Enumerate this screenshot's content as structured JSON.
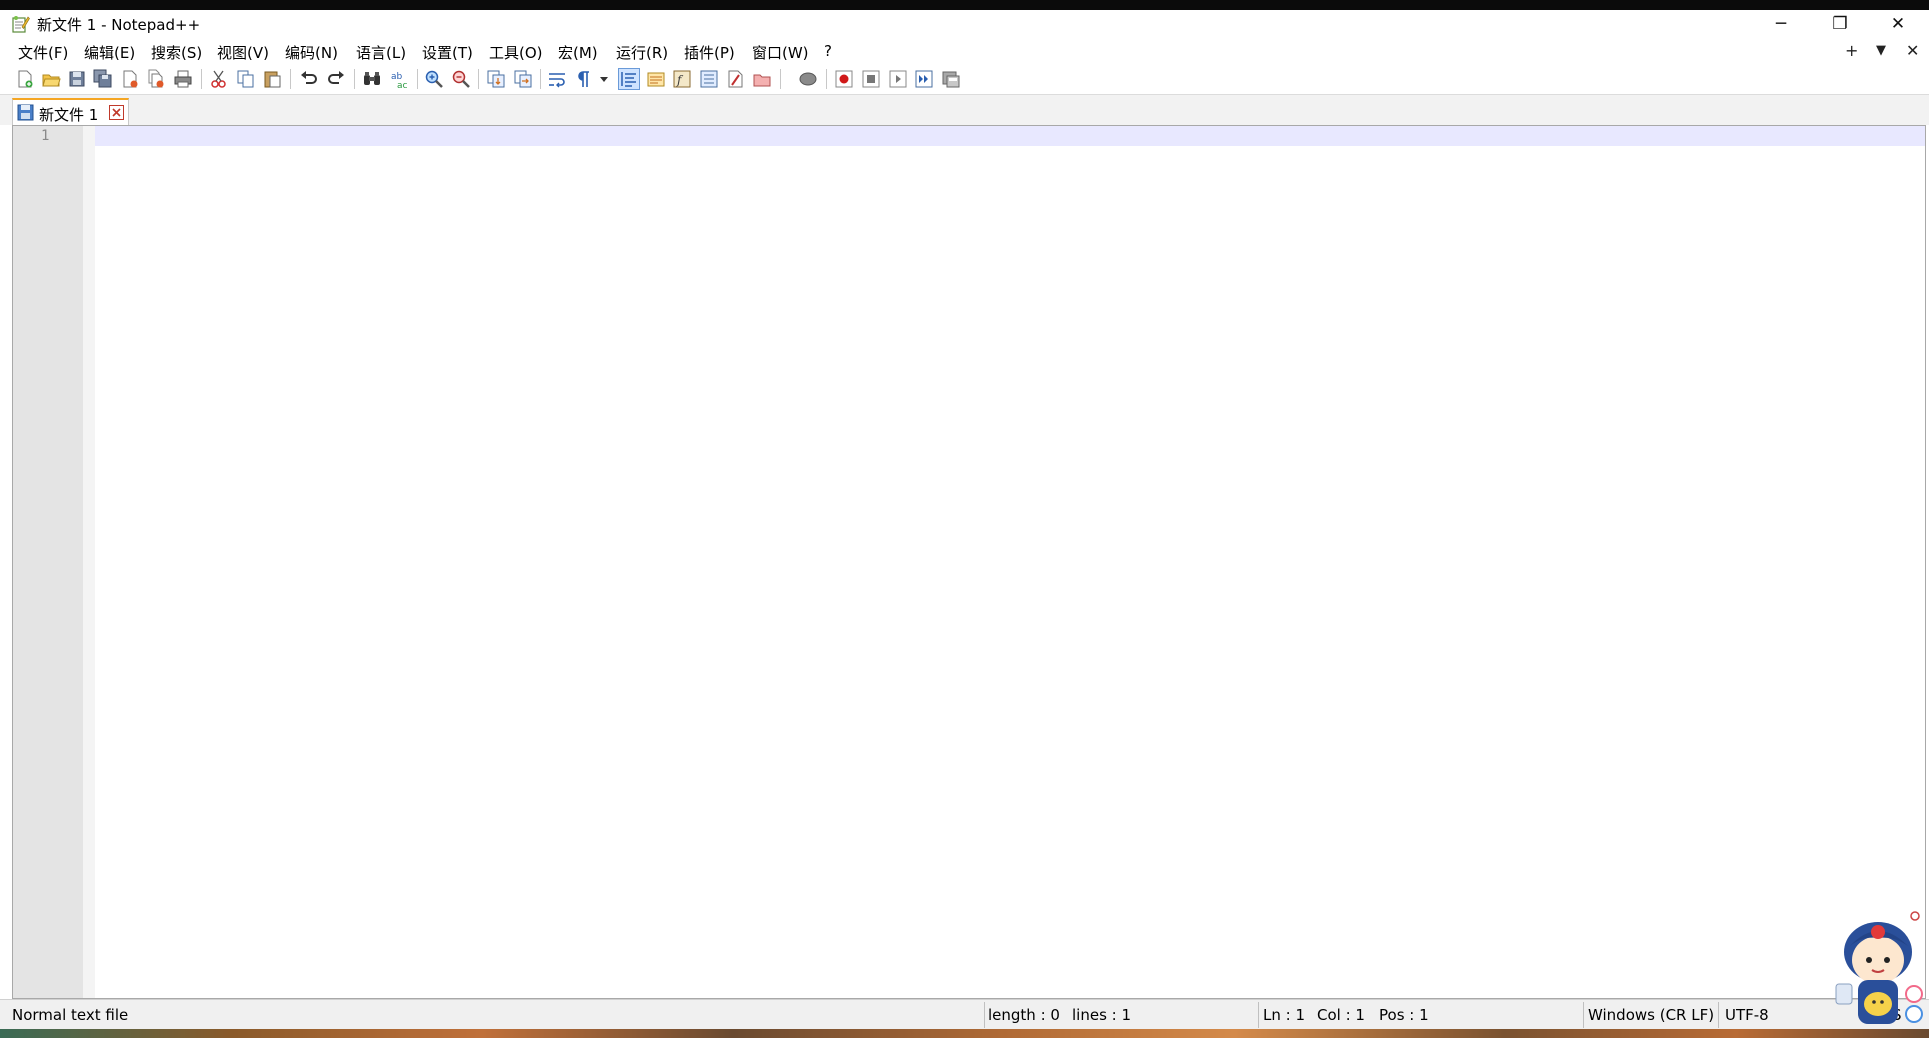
{
  "window": {
    "title": "新文件 1 - Notepad++",
    "minimize_glyph": "─",
    "restore_glyph": "❐",
    "close_glyph": "✕"
  },
  "menu": {
    "items": [
      "文件(F)",
      "编辑(E)",
      "搜索(S)",
      "视图(V)",
      "编码(N)",
      "语言(L)",
      "设置(T)",
      "工具(O)",
      "宏(M)",
      "运行(R)",
      "插件(P)",
      "窗口(W)",
      "?"
    ],
    "right_plus": "+",
    "right_dropdown": "▼",
    "right_close": "✕"
  },
  "toolbar": {
    "icons": [
      "new-file",
      "open-file",
      "save",
      "save-all",
      "close",
      "close-all",
      "print",
      "cut",
      "copy",
      "paste",
      "undo",
      "redo",
      "find",
      "replace",
      "zoom-in",
      "zoom-out",
      "sync-vertical",
      "sync-horizontal",
      "word-wrap",
      "show-all-characters",
      "indent-guide",
      "document-map",
      "function-list",
      "folder-workspace",
      "doc-list",
      "monitoring",
      "macro-record",
      "macro-stop",
      "macro-play",
      "macro-play-multiple",
      "macro-save"
    ]
  },
  "tabs": [
    {
      "label": "新文件 1",
      "active": true
    }
  ],
  "editor": {
    "line_numbers": [
      "1"
    ],
    "content": ""
  },
  "status": {
    "file_type": "Normal text file",
    "length": "length : 0",
    "lines": "lines : 1",
    "ln": "Ln : 1",
    "col": "Col : 1",
    "pos": "Pos : 1",
    "eol": "Windows (CR LF)",
    "encoding": "UTF-8",
    "mode": "S"
  },
  "colors": {
    "current_line": "#e8e8ff",
    "gutter": "#e4e4e4",
    "tab_accent": "#f5a623"
  }
}
